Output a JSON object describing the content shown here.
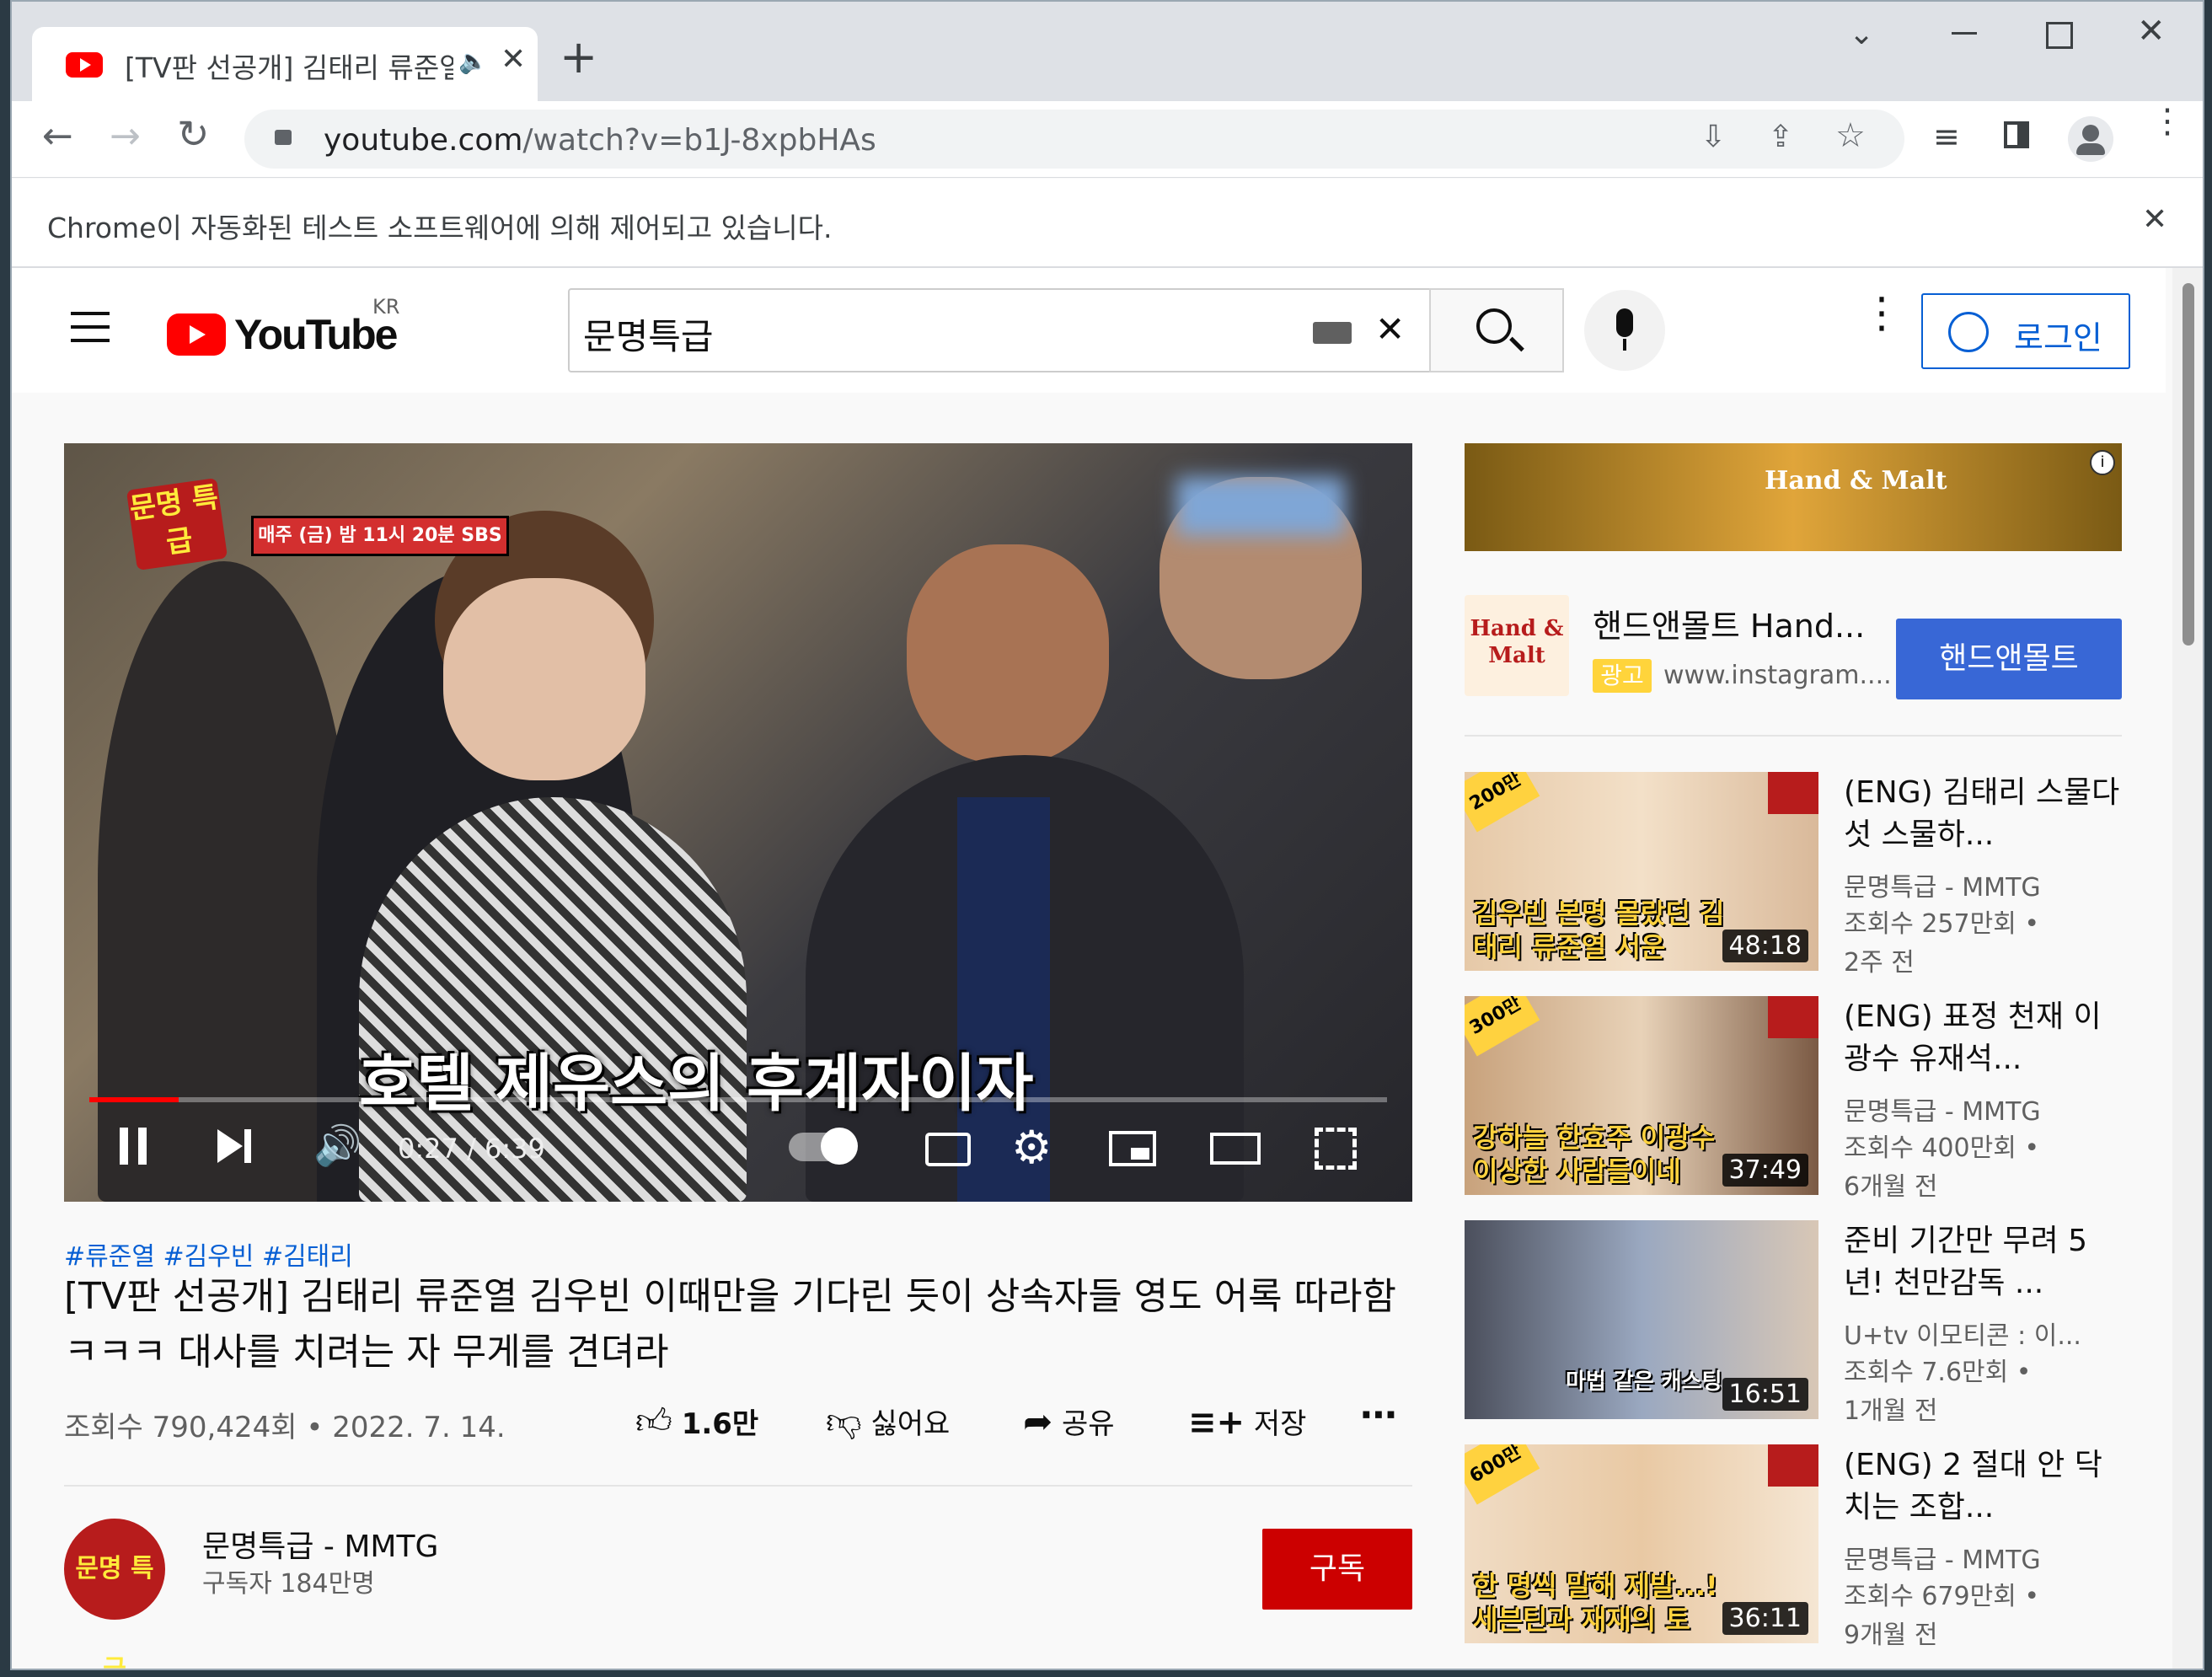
{
  "browser": {
    "tab_title": "[TV판 선공개] 김태리 류준열",
    "new_tab": "+",
    "url_host": "youtube.com",
    "url_path": "/watch?v=b1J-8xpbHAs",
    "automation_notice": "Chrome이 자동화된 테스트 소프트웨어에 의해 제어되고 있습니다."
  },
  "header": {
    "logo_text": "YouTube",
    "region": "KR",
    "search_value": "문명특급",
    "login_label": "로그인"
  },
  "player": {
    "badge_logo": "문명 특급",
    "badge_banner": "매주 (금) 밤 11시 20분 SBS",
    "subtitle": "호텔 제우스의 후계자이자",
    "time": "0:27 / 6:39",
    "progress": 0.069
  },
  "video": {
    "hashtags": "#류준열 #김우빈 #김태리",
    "title": "[TV판 선공개] 김태리 류준열 김우빈 이때만을 기다린 듯이 상속자들 영도 어록 따라함ㅋㅋㅋ 대사를 치려는 자 무게를 견뎌라",
    "views": "조회수 790,424회",
    "date": "2022. 7. 14.",
    "like_count": "1.6만",
    "dislike_label": "싫어요",
    "share_label": "공유",
    "save_label": "저장"
  },
  "channel": {
    "avatar_text": "문명 특급",
    "name": "문명특급 - MMTG",
    "subscribers": "구독자 184만명",
    "subscribe_label": "구독"
  },
  "ad": {
    "logo_text": "Hand & Malt",
    "title": "핸드앤몰트 Hand...",
    "badge": "광고",
    "url": "www.instagram....",
    "cta": "핸드앤몰트"
  },
  "recommendations": [
    {
      "corner": "200만",
      "caption": "김우빈 본명 몰랐던 김태리 류준열 서운",
      "duration": "48:18",
      "title": "(ENG) 김태리 스물다섯 스물하...",
      "channel": "문명특급 - MMTG",
      "views": "조회수 257만회 •",
      "age": "2주 전"
    },
    {
      "corner": "300만",
      "caption": "강하늘 한효주 이광수 이상한 사람들이네",
      "duration": "37:49",
      "title": "(ENG) 표정 천재 이광수 유재석...",
      "channel": "문명특급 - MMTG",
      "views": "조회수 400만회 •",
      "age": "6개월 전"
    },
    {
      "corner": "",
      "caption": "마법 같은 캐스팅",
      "duration": "16:51",
      "title": "준비 기간만 무려 5년! 천만감독 ...",
      "channel": "U+tv 이모티콘 : 이...",
      "views": "조회수 7.6만회 •",
      "age": "1개월 전"
    },
    {
      "corner": "600만",
      "caption": "한 명씩 말해 제발...! 세븐틴과 재재의 토",
      "duration": "36:11",
      "title": "(ENG) 2 절대 안 닥치는 조합...",
      "channel": "문명특급 - MMTG",
      "views": "조회수 679만회 •",
      "age": "9개월 전"
    }
  ],
  "colors": {
    "brand_red": "#ff0000",
    "link_blue": "#065fd4",
    "subscribe_red": "#cc0000"
  }
}
